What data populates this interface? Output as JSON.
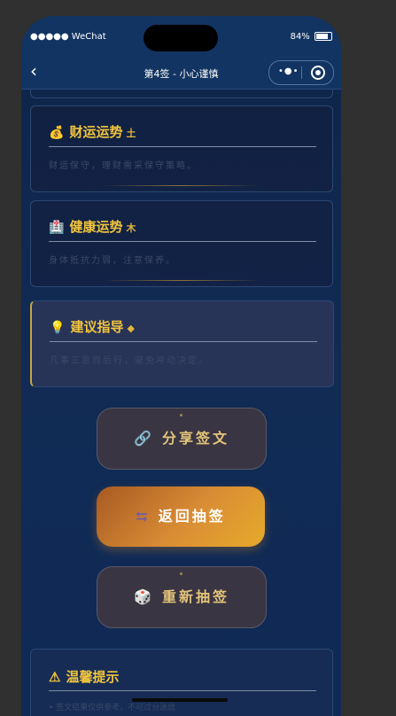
{
  "status": {
    "signal": "●●●●● WeChat",
    "battery": "84%"
  },
  "nav": {
    "back": "‹",
    "title": "第4签 - 小心谨慎",
    "more": "•●•"
  },
  "cards": [
    {
      "icon": "💰",
      "title": "财运运势",
      "tag": "土",
      "desc": "财运保守，理财需采保守策略。"
    },
    {
      "icon": "🏥",
      "title": "健康运势",
      "tag": "木",
      "desc": "身体抵抗力弱，注意保养。"
    },
    {
      "icon": "💡",
      "title": "建议指导",
      "tag": "◆",
      "desc": "凡事三思而后行，避免冲动决定。"
    }
  ],
  "buttons": {
    "share": {
      "icon": "🔗",
      "label": "分享签文"
    },
    "back_draw": {
      "icon": "⇆",
      "label": "返回抽签"
    },
    "redraw": {
      "icon": "🎲",
      "label": "重新抽签"
    }
  },
  "tip": {
    "icon": "⚠",
    "title": "温馨提示",
    "desc": "• 签文结果仅供参考，不可过分迷信"
  }
}
